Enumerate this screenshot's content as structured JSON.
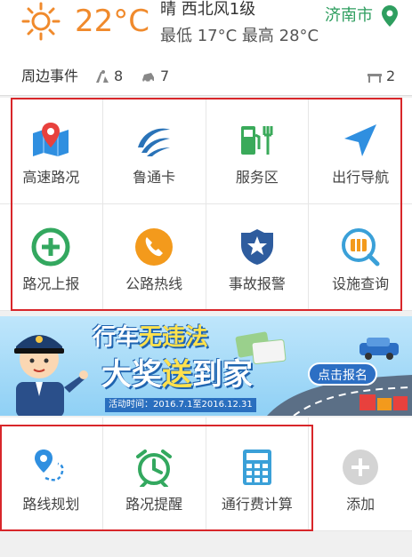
{
  "weather": {
    "temperature": "22°C",
    "condition": "晴 西北风1级",
    "range": "最低 17°C 最高 28°C",
    "city": "济南市"
  },
  "events": {
    "label": "周边事件",
    "construction_count": "8",
    "accident_count": "7",
    "other_count": "2"
  },
  "services": [
    {
      "label": "高速路况",
      "icon": "map-pin-icon",
      "color": "#e8413d"
    },
    {
      "label": "鲁通卡",
      "icon": "card-swoosh-icon",
      "color": "#2a73b8"
    },
    {
      "label": "服务区",
      "icon": "fuel-restaurant-icon",
      "color": "#3aaa5a"
    },
    {
      "label": "出行导航",
      "icon": "navigation-arrow-icon",
      "color": "#2f8fe0"
    },
    {
      "label": "路况上报",
      "icon": "plus-circle-icon",
      "color": "#33a85f"
    },
    {
      "label": "公路热线",
      "icon": "phone-icon",
      "color": "#f39a1c"
    },
    {
      "label": "事故报警",
      "icon": "police-badge-icon",
      "color": "#2e5c9e"
    },
    {
      "label": "设施查询",
      "icon": "search-road-icon",
      "color": "#3aa0d8"
    }
  ],
  "banner": {
    "title_line1_a": "行车",
    "title_line1_b": "无违法",
    "title_line2_a": "大奖",
    "title_line2_b": "送",
    "title_line2_c": "到家",
    "date": "活动时间：2016.7.1至2016.12.31",
    "button": "点击报名"
  },
  "tools": [
    {
      "label": "路线规划",
      "icon": "route-plan-icon",
      "color": "#2f8fe0"
    },
    {
      "label": "路况提醒",
      "icon": "alarm-clock-icon",
      "color": "#33a85f"
    },
    {
      "label": "通行费计算",
      "icon": "calculator-icon",
      "color": "#3aa0d8"
    },
    {
      "label": "添加",
      "icon": "add-circle-icon",
      "color": "#c8c8c8"
    }
  ],
  "colors": {
    "temperature": "#f08a2c",
    "city": "#2e9e5f",
    "highlight_border": "#d8262a"
  }
}
